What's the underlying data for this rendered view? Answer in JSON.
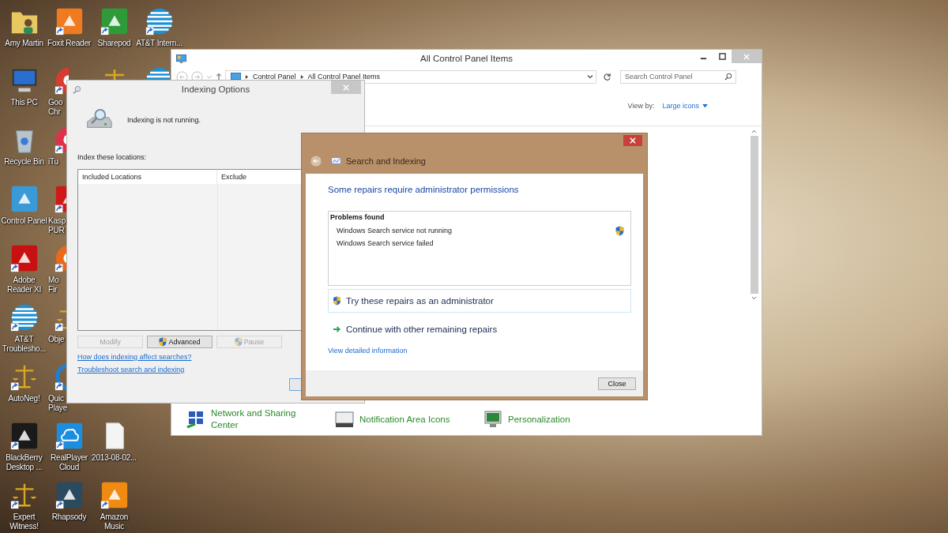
{
  "desktop_columns": [
    [
      {
        "label": "Amy Martin",
        "kind": "folder",
        "shortcut": false
      },
      {
        "label": "This PC",
        "kind": "monitor",
        "shortcut": false
      },
      {
        "label": "Recycle Bin",
        "kind": "bin",
        "shortcut": false
      },
      {
        "label": "Control Panel",
        "kind": "panel",
        "shortcut": false
      },
      {
        "label": "Adobe Reader XI",
        "kind": "adobe",
        "shortcut": true
      },
      {
        "label": "AT&T Troublesho...",
        "kind": "globe",
        "shortcut": true
      },
      {
        "label": "AutoNeg!",
        "kind": "scales",
        "shortcut": true
      },
      {
        "label": "BlackBerry Desktop ...",
        "kind": "blackberry",
        "shortcut": true
      },
      {
        "label": "Expert Witness!",
        "kind": "scales",
        "shortcut": true
      }
    ],
    [
      {
        "label": "Foxit Reader",
        "kind": "foxit",
        "shortcut": true
      },
      {
        "label": "Goo Chr",
        "kind": "chrome",
        "shortcut": true,
        "clipped": true
      },
      {
        "label": "iTu",
        "kind": "itunes",
        "shortcut": true,
        "clipped": true
      },
      {
        "label": "Kasp PUR",
        "kind": "kaspersky",
        "shortcut": true,
        "clipped": true
      },
      {
        "label": "Mo Fir",
        "kind": "firefox",
        "shortcut": true,
        "clipped": true
      },
      {
        "label": "Obje",
        "kind": "scales",
        "shortcut": true,
        "clipped": true
      },
      {
        "label": "Quic Playe",
        "kind": "quicktime",
        "shortcut": true,
        "clipped": true
      },
      {
        "label": "RealPlayer Cloud",
        "kind": "cloud",
        "shortcut": true
      },
      {
        "label": "Rhapsody",
        "kind": "rhapsody",
        "shortcut": true
      }
    ],
    [
      {
        "label": "Sharepod",
        "kind": "sharepod",
        "shortcut": true
      },
      {
        "kind": "scales",
        "shortcut": false,
        "clipped": true
      },
      {
        "kind": "empty"
      },
      {
        "kind": "empty"
      },
      {
        "kind": "empty"
      },
      {
        "kind": "empty"
      },
      {
        "kind": "empty"
      },
      {
        "label": "2013-08-02...",
        "kind": "doc",
        "shortcut": false
      },
      {
        "label": "Amazon Music",
        "kind": "amazon",
        "shortcut": true
      }
    ],
    [
      {
        "label": "AT&T Intern...",
        "kind": "globe",
        "shortcut": true
      },
      {
        "kind": "globe",
        "shortcut": false,
        "clipped": true
      }
    ]
  ],
  "control_panel": {
    "title": "All Control Panel Items",
    "breadcrumb": [
      "Control Panel",
      "All Control Panel Items"
    ],
    "search": {
      "placeholder": "Search Control Panel"
    },
    "view_by_label": "View by:",
    "view_by_value": "Large icons",
    "items": [
      {
        "label": "Network and Sharing Center",
        "kind": "network"
      },
      {
        "label": "Notification Area Icons",
        "kind": "notification"
      },
      {
        "label": "Personalization",
        "kind": "personalization"
      }
    ]
  },
  "indexing_options": {
    "title": "Indexing Options",
    "status": "Indexing is not running.",
    "locations_label": "Index these locations:",
    "columns": [
      "Included Locations",
      "Exclude"
    ],
    "buttons": [
      {
        "label": "Modify",
        "disabled": true,
        "shield": false
      },
      {
        "label": "Advanced",
        "disabled": false,
        "shield": true
      },
      {
        "label": "Pause",
        "disabled": true,
        "shield": true
      }
    ],
    "links": [
      "How does indexing affect searches?",
      "Troubleshoot search and indexing"
    ]
  },
  "troubleshooter": {
    "title": "Search and Indexing",
    "heading": "Some repairs require administrator permissions",
    "problems_title": "Problems found",
    "problems": [
      {
        "text": "Windows Search service not running",
        "admin": true
      },
      {
        "text": "Windows Search service failed",
        "admin": false
      }
    ],
    "options": [
      {
        "label": "Try these repairs as an administrator",
        "kind": "admin"
      },
      {
        "label": "Continue with other remaining repairs",
        "kind": "continue"
      }
    ],
    "link": "View detailed information",
    "close_button": "Close"
  }
}
